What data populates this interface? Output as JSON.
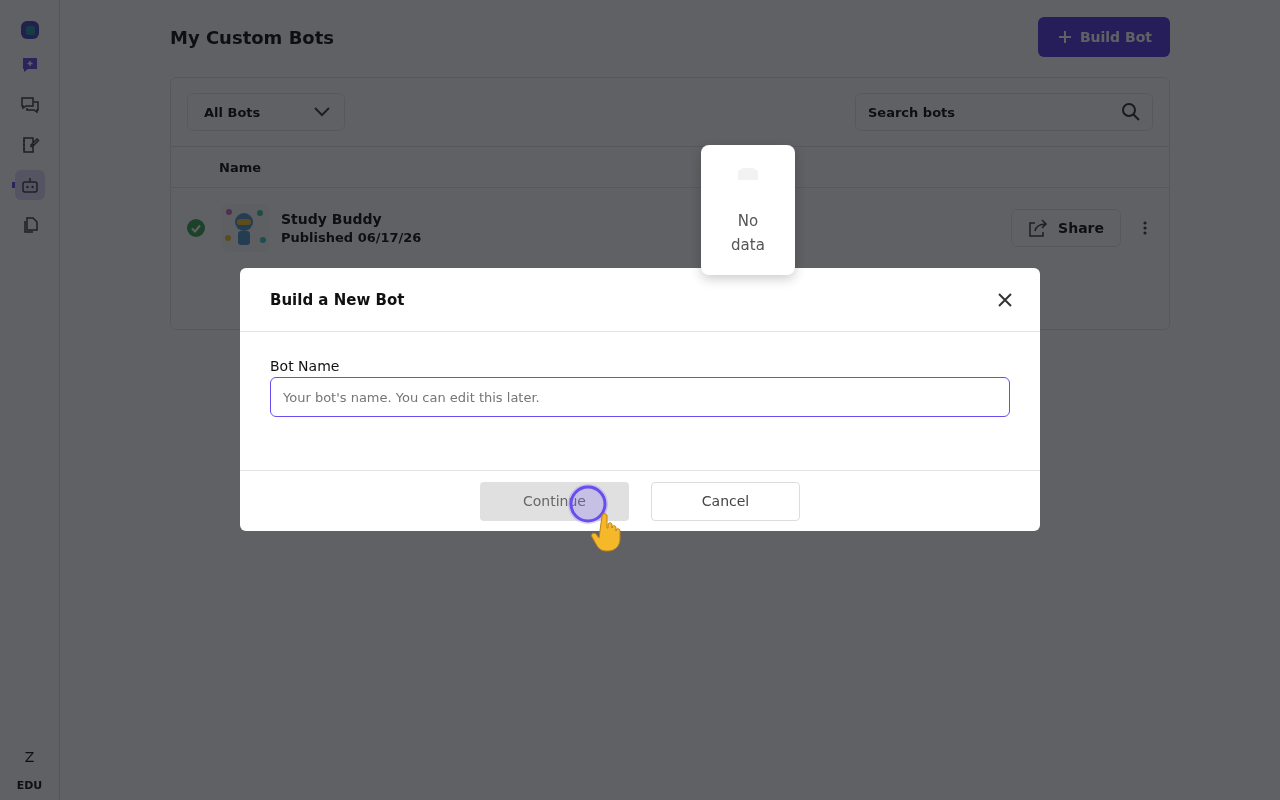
{
  "sidebar": {
    "nav": [
      {
        "kind": "new-chat",
        "selected": false
      },
      {
        "kind": "chats",
        "selected": false
      },
      {
        "kind": "notes",
        "selected": false
      },
      {
        "kind": "bots",
        "selected": true
      },
      {
        "kind": "documents",
        "selected": false
      }
    ],
    "user_initial": "Z",
    "plan": "EDU"
  },
  "page": {
    "title": "My Custom Bots",
    "build_button": "Build Bot",
    "filter": {
      "value": "All Bots"
    },
    "search": {
      "placeholder": "Search bots"
    },
    "table": {
      "columns": [
        "Name"
      ],
      "rows": [
        {
          "name": "Study Buddy",
          "status": "Published 06/17/26",
          "published": true,
          "share": "Share"
        }
      ]
    }
  },
  "popover": {
    "text": "No data"
  },
  "modal": {
    "title": "Build a New Bot",
    "field": {
      "label": "Bot Name",
      "placeholder": "Your bot's name. You can edit this later.",
      "focused": true
    },
    "buttons": [
      {
        "label": "Continue",
        "kind": "primary",
        "disabled": true
      },
      {
        "label": "Cancel",
        "kind": "secondary",
        "disabled": false
      }
    ]
  }
}
